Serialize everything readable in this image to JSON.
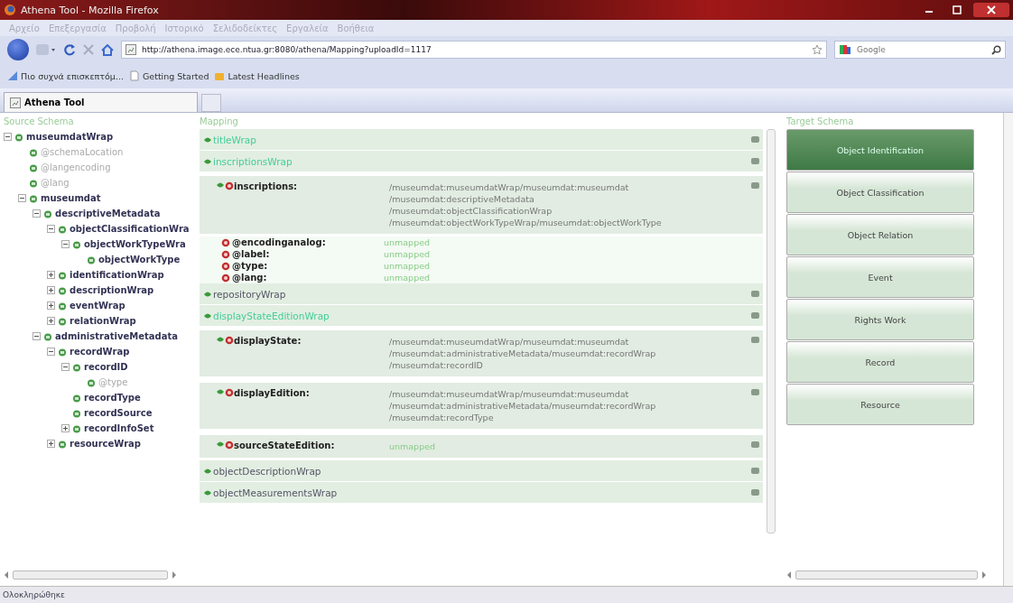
{
  "window": {
    "title": "Athena Tool - Mozilla Firefox"
  },
  "menu_bar": [
    "Αρχείο",
    "Επεξεργασία",
    "Προβολή",
    "Ιστορικό",
    "Σελιδοδείκτες",
    "Εργαλεία",
    "Βοήθεια"
  ],
  "address_bar": {
    "value": "http://athena.image.ece.ntua.gr:8080/athena/Mapping?uploadId=1117"
  },
  "search": {
    "placeholder": "Google"
  },
  "bookmarks": [
    "Πιο συχνά επισκεπτόμ...",
    "Getting Started",
    "Latest Headlines"
  ],
  "tabs": [
    {
      "label": "Athena Tool",
      "selected": true
    }
  ],
  "source_schema": {
    "title": "Source Schema",
    "tree": [
      {
        "label": "museumdatWrap",
        "kind": "element",
        "expanded": true,
        "children": [
          {
            "label": "@schemaLocation",
            "kind": "attribute"
          },
          {
            "label": "@langencoding",
            "kind": "attribute"
          },
          {
            "label": "@lang",
            "kind": "attribute"
          },
          {
            "label": "museumdat",
            "kind": "element",
            "expanded": true,
            "children": [
              {
                "label": "descriptiveMetadata",
                "kind": "element",
                "expanded": true,
                "children": [
                  {
                    "label": "objectClassificationWra",
                    "kind": "element",
                    "expanded": true,
                    "children": [
                      {
                        "label": "objectWorkTypeWra",
                        "kind": "element",
                        "expanded": true,
                        "children": [
                          {
                            "label": "objectWorkType",
                            "kind": "element"
                          }
                        ]
                      }
                    ]
                  },
                  {
                    "label": "identificationWrap",
                    "kind": "element",
                    "expanded": false
                  },
                  {
                    "label": "descriptionWrap",
                    "kind": "element",
                    "expanded": false
                  },
                  {
                    "label": "eventWrap",
                    "kind": "element",
                    "expanded": false
                  },
                  {
                    "label": "relationWrap",
                    "kind": "element",
                    "expanded": false
                  }
                ]
              },
              {
                "label": "administrativeMetadata",
                "kind": "element",
                "expanded": true,
                "children": [
                  {
                    "label": "recordWrap",
                    "kind": "element",
                    "expanded": true,
                    "children": [
                      {
                        "label": "recordID",
                        "kind": "element",
                        "expanded": true,
                        "children": [
                          {
                            "label": "@type",
                            "kind": "attribute"
                          }
                        ]
                      },
                      {
                        "label": "recordType",
                        "kind": "element"
                      },
                      {
                        "label": "recordSource",
                        "kind": "element"
                      },
                      {
                        "label": "recordInfoSet",
                        "kind": "element",
                        "expanded": false
                      }
                    ]
                  },
                  {
                    "label": "resourceWrap",
                    "kind": "element",
                    "expanded": false
                  }
                ]
              }
            ]
          }
        ]
      }
    ]
  },
  "mapping": {
    "title": "Mapping",
    "items": [
      {
        "kind": "wrap",
        "label": "titleWrap",
        "highlighted": true
      },
      {
        "kind": "wrap",
        "label": "inscriptionsWrap",
        "highlighted": true
      },
      {
        "kind": "element",
        "label": "inscriptions:",
        "paths": [
          "/museumdat:museumdatWrap/museumdat:museumdat",
          "/museumdat:descriptiveMetadata",
          "/museumdat:objectClassificationWrap",
          "/museumdat:objectWorkTypeWrap/museumdat:objectWorkType"
        ]
      },
      {
        "kind": "attribute",
        "label": "@encodinganalog:",
        "value": "unmapped"
      },
      {
        "kind": "attribute",
        "label": "@label:",
        "value": "unmapped"
      },
      {
        "kind": "attribute",
        "label": "@type:",
        "value": "unmapped"
      },
      {
        "kind": "attribute",
        "label": "@lang:",
        "value": "unmapped"
      },
      {
        "kind": "wrap",
        "label": "repositoryWrap",
        "highlighted": false
      },
      {
        "kind": "wrap",
        "label": "displayStateEditionWrap",
        "highlighted": true
      },
      {
        "kind": "element",
        "label": "displayState:",
        "paths": [
          "/museumdat:museumdatWrap/museumdat:museumdat",
          "/museumdat:administrativeMetadata/museumdat:recordWrap",
          "/museumdat:recordID"
        ]
      },
      {
        "kind": "element",
        "label": "displayEdition:",
        "paths": [
          "/museumdat:museumdatWrap/museumdat:museumdat",
          "/museumdat:administrativeMetadata/museumdat:recordWrap",
          "/museumdat:recordType"
        ]
      },
      {
        "kind": "element",
        "label": "sourceStateEdition:",
        "value": "unmapped"
      },
      {
        "kind": "wrap",
        "label": "objectDescriptionWrap",
        "highlighted": false
      },
      {
        "kind": "wrap",
        "label": "objectMeasurementsWrap",
        "highlighted": false
      }
    ]
  },
  "target_schema": {
    "title": "Target Schema",
    "buttons": [
      {
        "label": "Object Identification",
        "selected": true
      },
      {
        "label": "Object Classification",
        "selected": false
      },
      {
        "label": "Object Relation",
        "selected": false
      },
      {
        "label": "Event",
        "selected": false
      },
      {
        "label": "Rights Work",
        "selected": false
      },
      {
        "label": "Record",
        "selected": false
      },
      {
        "label": "Resource",
        "selected": false
      }
    ]
  },
  "status_bar": "Ολοκληρώθηκε"
}
